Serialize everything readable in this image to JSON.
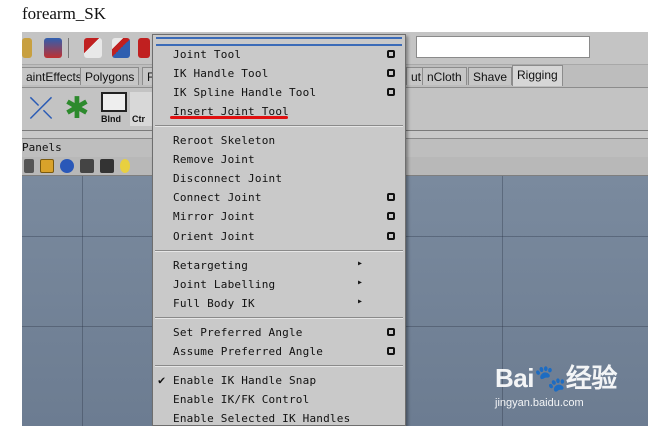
{
  "page": {
    "caption": "forearm_SK"
  },
  "toolbar": {
    "search_value": ""
  },
  "shelf_tabs": [
    {
      "label": "aintEffects",
      "active": false
    },
    {
      "label": "Polygons",
      "active": false
    },
    {
      "label": "F",
      "active": false
    },
    {
      "label": "ut",
      "active": false
    },
    {
      "label": "nCloth",
      "active": false
    },
    {
      "label": "Shave",
      "active": false
    },
    {
      "label": "Rigging",
      "active": true
    }
  ],
  "shelf": {
    "blnd_label": "Blnd",
    "ctr_label": "Ctr"
  },
  "panel": {
    "menu_label": "Panels"
  },
  "menu": {
    "items": [
      {
        "label": "Joint Tool",
        "option_box": true
      },
      {
        "label": "IK Handle Tool",
        "option_box": true
      },
      {
        "label": "IK Spline Handle Tool",
        "option_box": true
      },
      {
        "label": "Insert Joint Tool",
        "option_box": false,
        "highlighted": true
      },
      {
        "label": "Reroot Skeleton"
      },
      {
        "label": "Remove Joint"
      },
      {
        "label": "Disconnect Joint"
      },
      {
        "label": "Connect Joint",
        "option_box": true
      },
      {
        "label": "Mirror Joint",
        "option_box": true
      },
      {
        "label": "Orient Joint",
        "option_box": true
      },
      {
        "label": "Retargeting",
        "submenu": true
      },
      {
        "label": "Joint Labelling",
        "submenu": true
      },
      {
        "label": "Full Body IK",
        "submenu": true
      },
      {
        "label": "Set Preferred Angle",
        "option_box": true
      },
      {
        "label": "Assume Preferred Angle",
        "option_box": true
      },
      {
        "label": "Enable IK Handle Snap",
        "checked": true
      },
      {
        "label": "Enable IK/FK Control"
      },
      {
        "label": "Enable Selected IK Handles"
      }
    ],
    "submenu_glyph": "▸",
    "check_glyph": "✔"
  },
  "watermark": {
    "logo_text": "Bai🐾经验",
    "url": "jingyan.baidu.com"
  },
  "colors": {
    "highlight_underline": "#e01010",
    "viewport": "#73839a"
  }
}
